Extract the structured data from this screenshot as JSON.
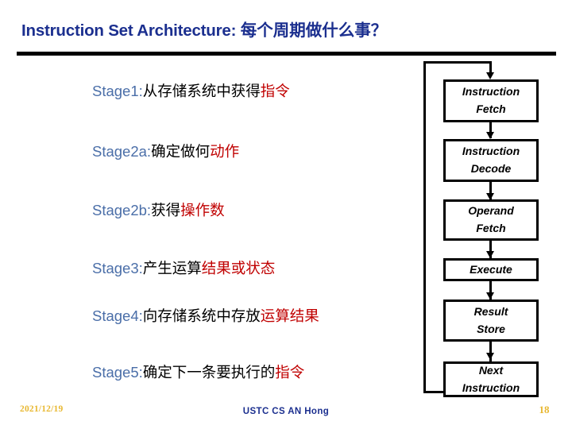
{
  "slide": {
    "title_en": "Instruction Set Architecture: ",
    "title_zh": "每个周期做什么事？",
    "title_color": "#1b2f8f"
  },
  "stages": [
    {
      "label": "Stage1:",
      "mid": "从存储系统中获得",
      "highlight": "指令"
    },
    {
      "label": "Stage2a:",
      "mid": "确定做何",
      "highlight": "动作"
    },
    {
      "label": "Stage2b:",
      "mid": "获得",
      "highlight": "操作数"
    },
    {
      "label": "Stage3:",
      "mid": "产生运算",
      "highlight": "结果或状态"
    },
    {
      "label": "Stage4:",
      "mid": "向存储系统中存放",
      "highlight": "运算结果"
    },
    {
      "label": "Stage5:",
      "mid": "确定下一条要执行的",
      "highlight": "指令"
    }
  ],
  "flowchart": {
    "boxes": [
      {
        "line1": "Instruction",
        "line2": "Fetch"
      },
      {
        "line1": "Instruction",
        "line2": "Decode"
      },
      {
        "line1": "Operand",
        "line2": "Fetch"
      },
      {
        "line1": "Execute",
        "line2": ""
      },
      {
        "line1": "Result",
        "line2": "Store"
      },
      {
        "line1": "Next",
        "line2": "Instruction"
      }
    ]
  },
  "footer": {
    "date": "2021/12/19",
    "center": "USTC CS AN Hong",
    "page": "18"
  },
  "colors": {
    "stage_label": "#4a6ea8",
    "stage_highlight": "#c00000",
    "title": "#1b2f8f",
    "footer_gold": "#e8b832",
    "footer_navy": "#1b2f8f"
  }
}
